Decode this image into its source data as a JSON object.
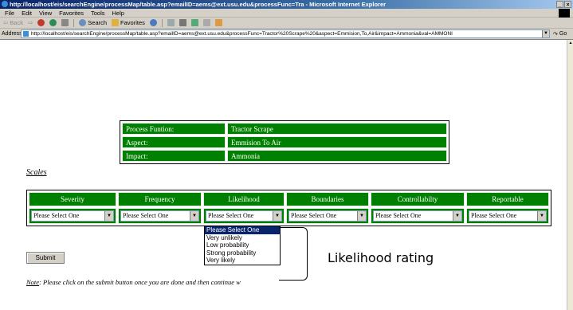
{
  "browser": {
    "title": "http://localhost/eis/searchEngine/processMap/table.asp?emailID=aems@ext.usu.edu&processFunc=Tra - Microsoft Internet Explorer",
    "window_buttons": [
      "_",
      "×"
    ],
    "menu": [
      "File",
      "Edit",
      "View",
      "Favorites",
      "Tools",
      "Help"
    ],
    "toolbar": {
      "back": "Back",
      "search": "Search",
      "favorites": "Favorites"
    },
    "address_label": "Address",
    "address_url": "http://localhost/eis/searchEngine/processMap/table.asp?emailID=aems@ext.usu.edu&processFunc=Tractor%20Scrape%20&aspect=Emmision,To,Air&impact=Ammonia&val=AMMONI",
    "go_label": "Go"
  },
  "process": {
    "rows": [
      {
        "label": "Process Funtion:",
        "value": "Tractor Scrape"
      },
      {
        "label": "Aspect:",
        "value": "Emmision To Air"
      },
      {
        "label": "Impact:",
        "value": "Ammonia"
      }
    ]
  },
  "scales": {
    "title": "Scales",
    "columns": [
      "Severity",
      "Frequency",
      "Likelihood",
      "Boundaries",
      "Controllabilty",
      "Reportable"
    ],
    "select_value": "Please Select One"
  },
  "dropdown": {
    "options": [
      "Please Select One",
      "Very unlikely",
      "Low probability",
      "Strong probability",
      "Very likely"
    ],
    "highlighted": "Please Select One"
  },
  "annotation": "Likelihood rating",
  "submit_label": "Submit",
  "note": {
    "label": "Note",
    "text": ": Please click on the submit button once you are done and then continue w"
  },
  "colors": {
    "table_green": "#008000",
    "highlight": "#0a246a"
  }
}
